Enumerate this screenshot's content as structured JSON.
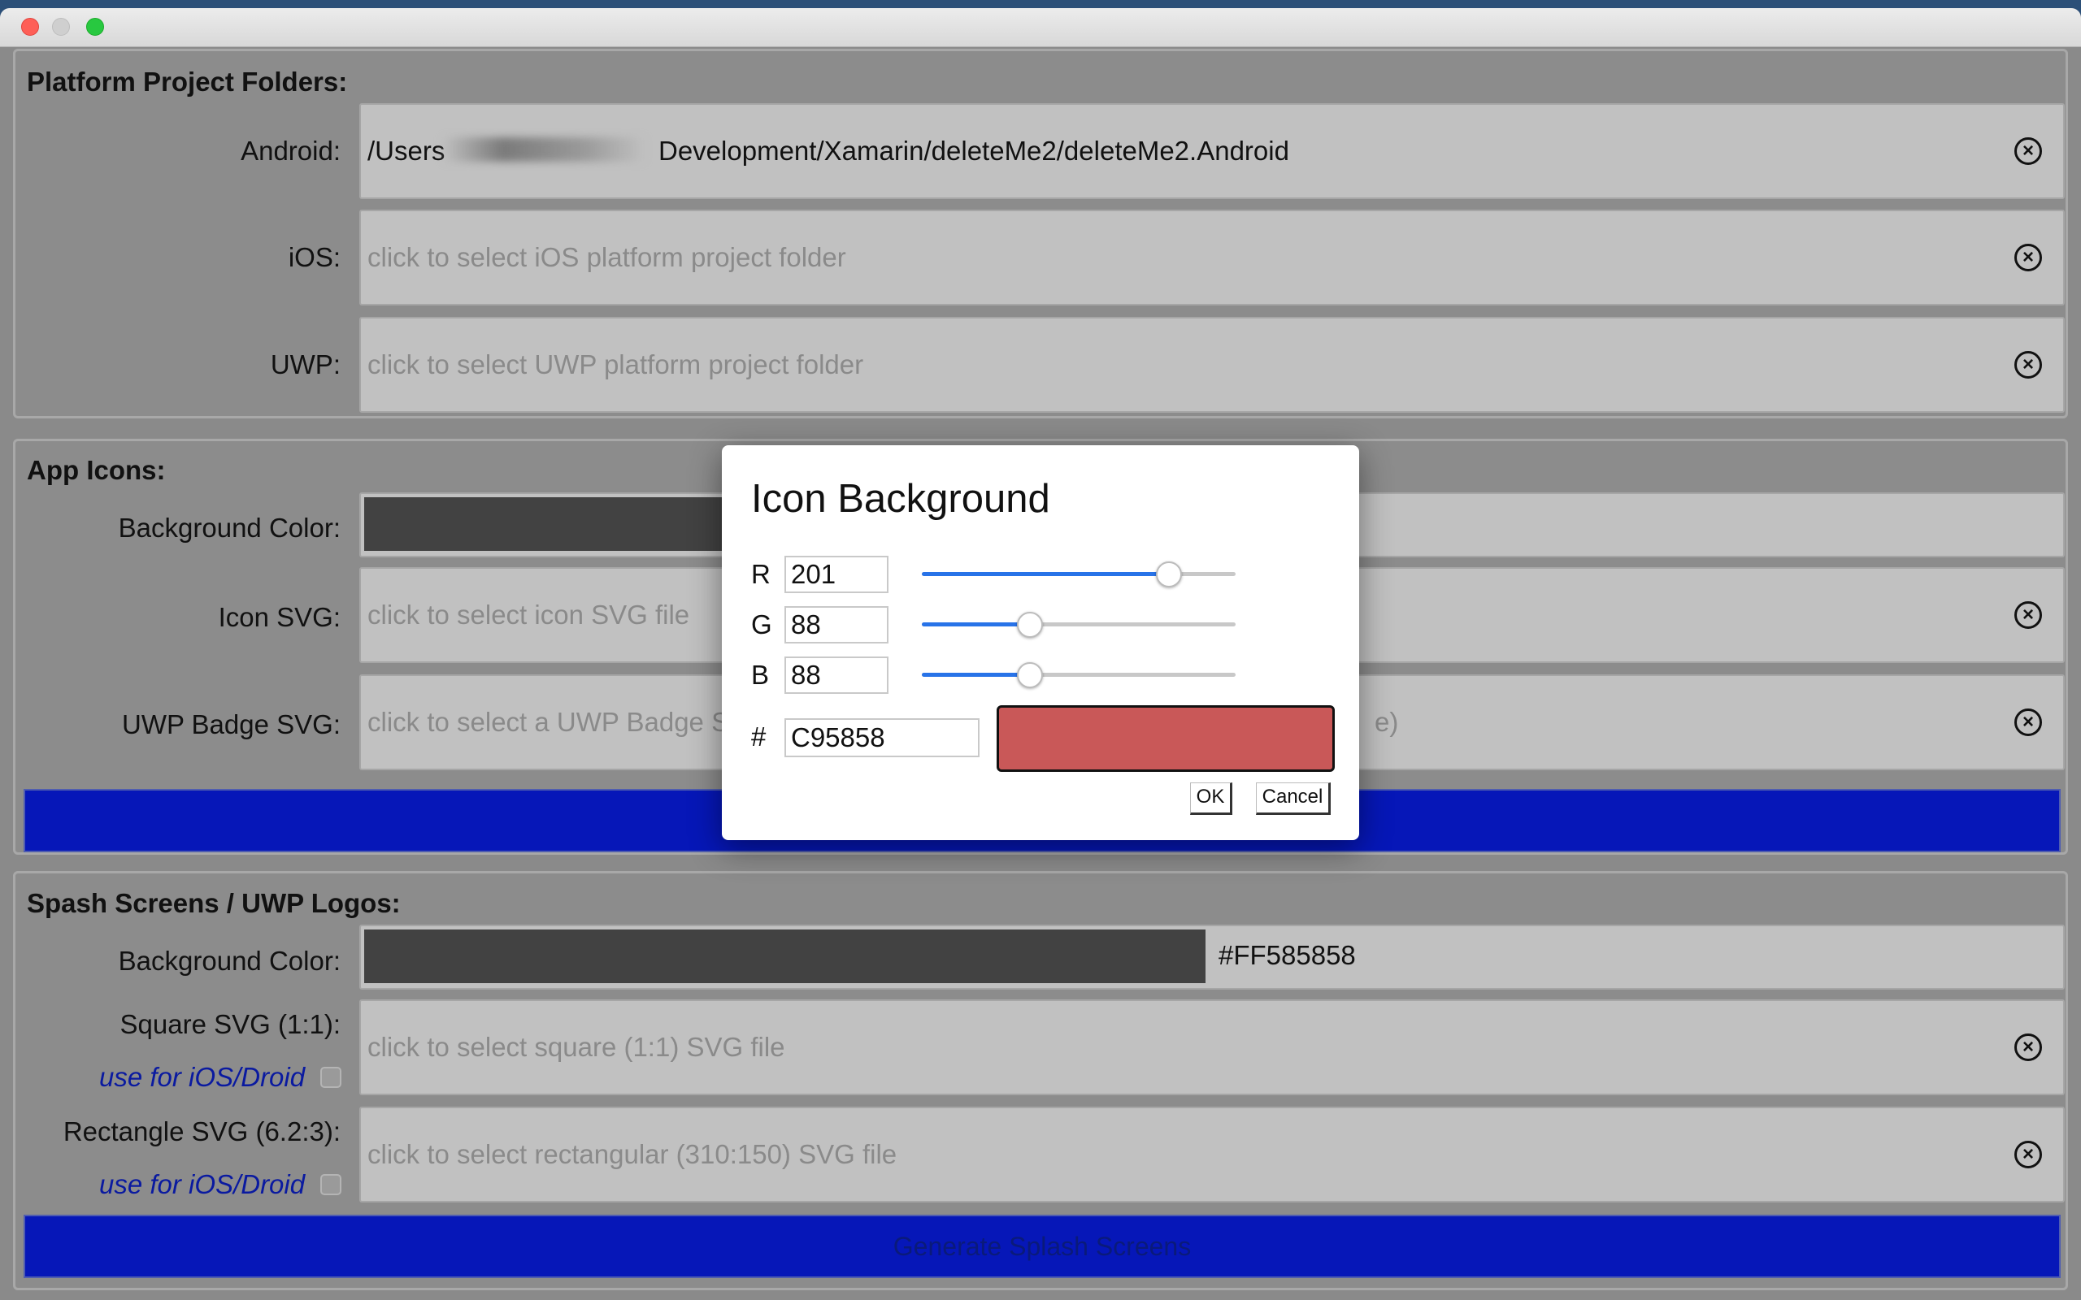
{
  "window": {
    "title": ""
  },
  "platform_folders": {
    "title": "Platform Project Folders:",
    "android": {
      "label": "Android:",
      "value_prefix": "/Users",
      "value_suffix": "Development/Xamarin/deleteMe2/deleteMe2.Android"
    },
    "ios": {
      "label": "iOS:",
      "placeholder": "click to select iOS platform project folder"
    },
    "uwp": {
      "label": "UWP:",
      "placeholder": "click to select UWP platform project folder"
    }
  },
  "app_icons": {
    "title": "App Icons:",
    "background_color": {
      "label": "Background Color:"
    },
    "icon_svg": {
      "label": "Icon SVG:",
      "placeholder": "click to select icon SVG file"
    },
    "uwp_badge_svg": {
      "label": "UWP Badge SVG:",
      "placeholder_visible_left": "click to select a UWP Badge S",
      "placeholder_visible_right": "e)"
    }
  },
  "splash": {
    "title": "Spash Screens / UWP Logos:",
    "background_color": {
      "label": "Background Color:",
      "value": "#FF585858",
      "swatch_color": "#424242"
    },
    "square_svg": {
      "label": "Square SVG (1:1):",
      "placeholder": "click to select square (1:1) SVG file",
      "use_for": "use for iOS/Droid"
    },
    "rect_svg": {
      "label": "Rectangle SVG (6.2:3):",
      "placeholder": "click to select rectangular (310:150) SVG file",
      "use_for": "use for iOS/Droid"
    },
    "generate_label": "Generate Splash Screens"
  },
  "dialog": {
    "title": "Icon Background",
    "r": {
      "label": "R",
      "value": "201",
      "level": 201
    },
    "g": {
      "label": "G",
      "value": "88",
      "level": 88
    },
    "b": {
      "label": "B",
      "value": "88",
      "level": 88
    },
    "hex_label": "#",
    "hex_value": "C95858",
    "preview_color": "#C95858",
    "ok_label": "OK",
    "cancel_label": "Cancel"
  },
  "icons": {
    "clear": "circle-x-icon"
  },
  "colors": {
    "accent_button": "#0617b8",
    "slider_accent": "#2873e8"
  }
}
